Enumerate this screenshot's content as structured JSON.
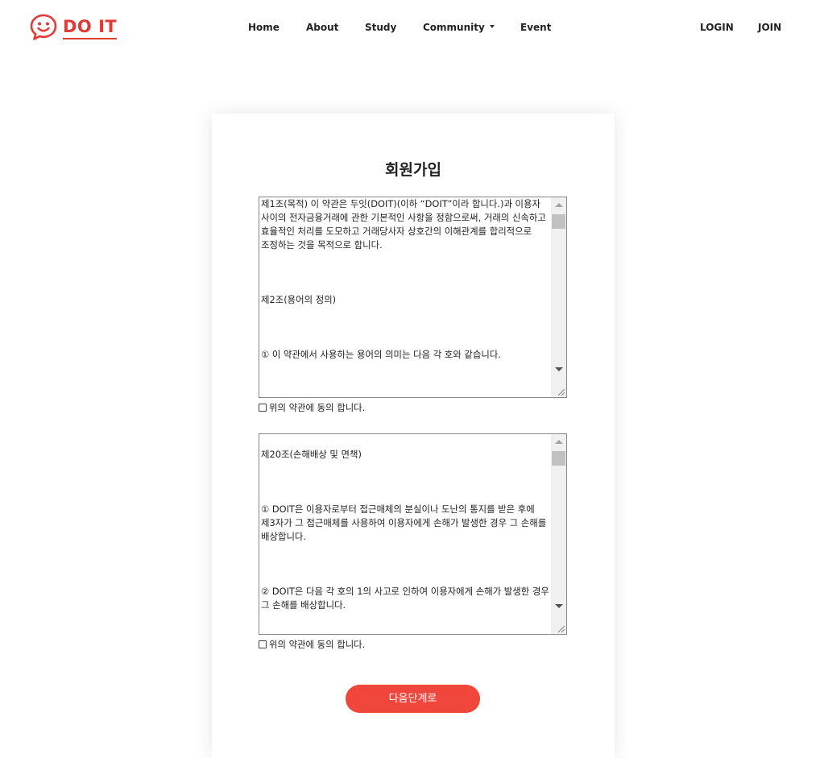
{
  "header": {
    "logo_text": "DO IT",
    "nav": {
      "home": "Home",
      "about": "About",
      "study": "Study",
      "community": "Community",
      "event": "Event"
    },
    "auth": {
      "login": "LOGIN",
      "join": "JOIN"
    }
  },
  "colors": {
    "brand_red": "#e53935",
    "button_red": "#f0463c"
  },
  "icons": {
    "logo": "smiley-chat-bubble-icon",
    "community_dropdown": "caret-down-icon"
  },
  "signup": {
    "title": "회원가입",
    "terms1": {
      "paragraphs": [
        "제1조(목적) 이 약관은 두잇(DOIT)(이하 “DOIT”이라 합니다.)과 이용자 사이의 전자금융거래에 관한 기본적인 사항을 정함으로써, 거래의 신속하고 효율적인 처리를 도모하고 거래당사자 상호간의 이해관계를 합리적으로 조정하는 것을 목적으로 합니다.",
        "",
        "",
        "",
        "제2조(용어의 정의)",
        "",
        "",
        "",
        "① 이 약관에서 사용하는 용어의 의미는 다음 각 호와 같습니다."
      ],
      "agree_label": "위의 약관에 동의 합니다."
    },
    "terms2": {
      "paragraphs": [
        "",
        "제20조(손해배상 및 면책)",
        "",
        "",
        "",
        "① DOIT은 이용자로부터 접근매체의 분실이나 도난의 통지를 받은 후에 제3자가 그 접근매체를 사용하여 이용자에게 손해가 발생한 경우 그 손해를 배상합니다.",
        "",
        "",
        "",
        "② DOIT은 다음 각 호의 1의 사고로 인하여 이용자에게 손해가 발생한 경우 그 손해를 배상합니다."
      ],
      "agree_label": "위의 약관에 동의 합니다."
    },
    "next_button": "다음단계로"
  }
}
